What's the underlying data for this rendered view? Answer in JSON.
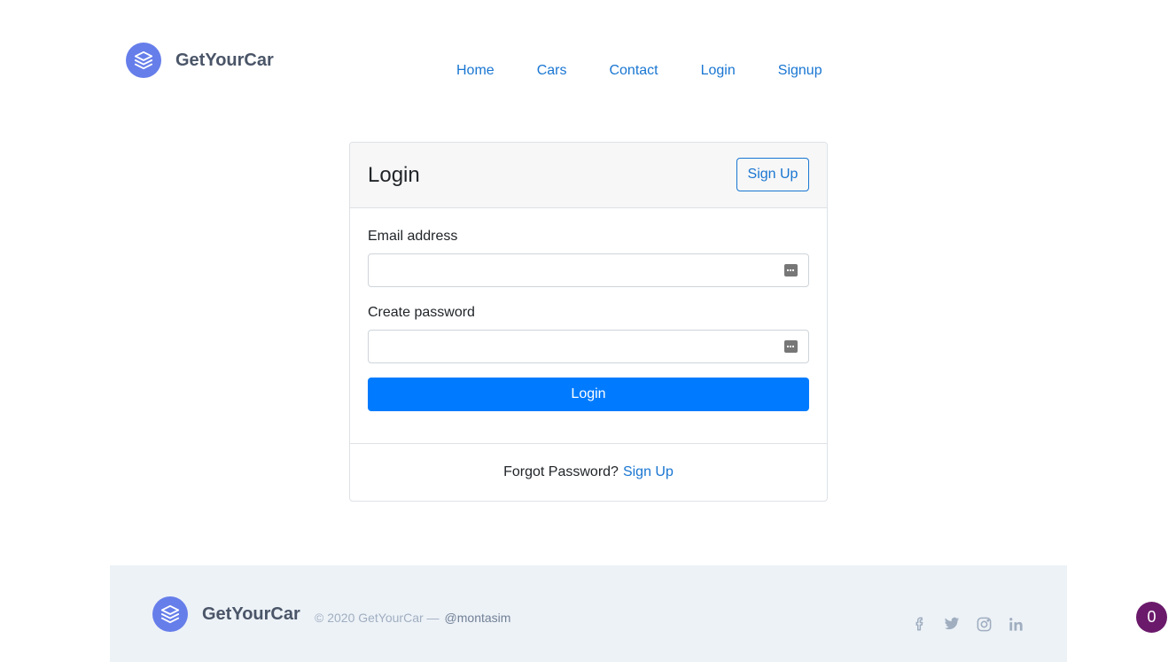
{
  "brand": {
    "name": "GetYourCar",
    "logo_icon": "layers-icon",
    "logo_color": "#667eea"
  },
  "nav": {
    "items": [
      {
        "label": "Home"
      },
      {
        "label": "Cars"
      },
      {
        "label": "Contact"
      },
      {
        "label": "Login"
      },
      {
        "label": "Signup"
      }
    ],
    "link_color": "#1976d2"
  },
  "login_card": {
    "title": "Login",
    "signup_button": "Sign Up",
    "email_label": "Email address",
    "email_value": "",
    "password_label": "Create password",
    "password_value": "",
    "input_icon": "password-manager-icon",
    "submit_button": "Login",
    "submit_color": "#007bff",
    "footer_text": "Forgot Password?",
    "footer_link": "Sign Up"
  },
  "footer": {
    "brand_name": "GetYourCar",
    "copyright": "© 2020 GetYourCar —",
    "author_handle": "@montasim",
    "socials": [
      "facebook-icon",
      "twitter-icon",
      "instagram-icon",
      "linkedin-icon"
    ],
    "background": "#edf2f7"
  },
  "floating_badge": {
    "count": "0",
    "color": "#6b1a6b"
  }
}
